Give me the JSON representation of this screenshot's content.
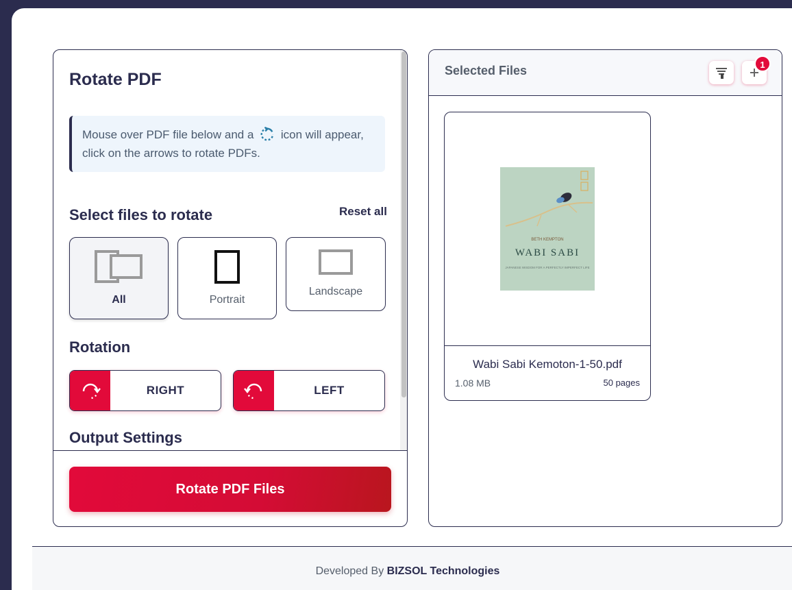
{
  "left_panel": {
    "title": "Rotate PDF",
    "info_before": "Mouse over PDF file below and a",
    "info_after": "icon will appear, click on the arrows to rotate PDFs.",
    "select_heading": "Select files to rotate",
    "reset_label": "Reset all",
    "options": [
      {
        "label": "All",
        "selected": true
      },
      {
        "label": "Portrait",
        "selected": false
      },
      {
        "label": "Landscape",
        "selected": false
      }
    ],
    "rotation_heading": "Rotation",
    "right_label": "RIGHT",
    "left_label": "LEFT",
    "output_heading": "Output Settings",
    "submit_label": "Rotate PDF Files"
  },
  "right_panel": {
    "heading": "Selected Files",
    "badge_count": "1",
    "file": {
      "name": "Wabi Sabi Kemoton-1-50.pdf",
      "size": "1.08 MB",
      "pages": "50 pages",
      "cover_author": "BETH KEMPTON",
      "cover_title": "WABI SABI",
      "cover_subtitle": "JAPANESE WISDOM FOR A PERFECTLY IMPERFECT LIFE"
    }
  },
  "footer": {
    "prefix": "Developed By",
    "company": "BIZSOL Technologies"
  },
  "colors": {
    "primary": "#2b2c4e",
    "accent": "#e20a3a",
    "info_bg": "#eef5fc",
    "rotate_icon": "#2a7fa8"
  }
}
